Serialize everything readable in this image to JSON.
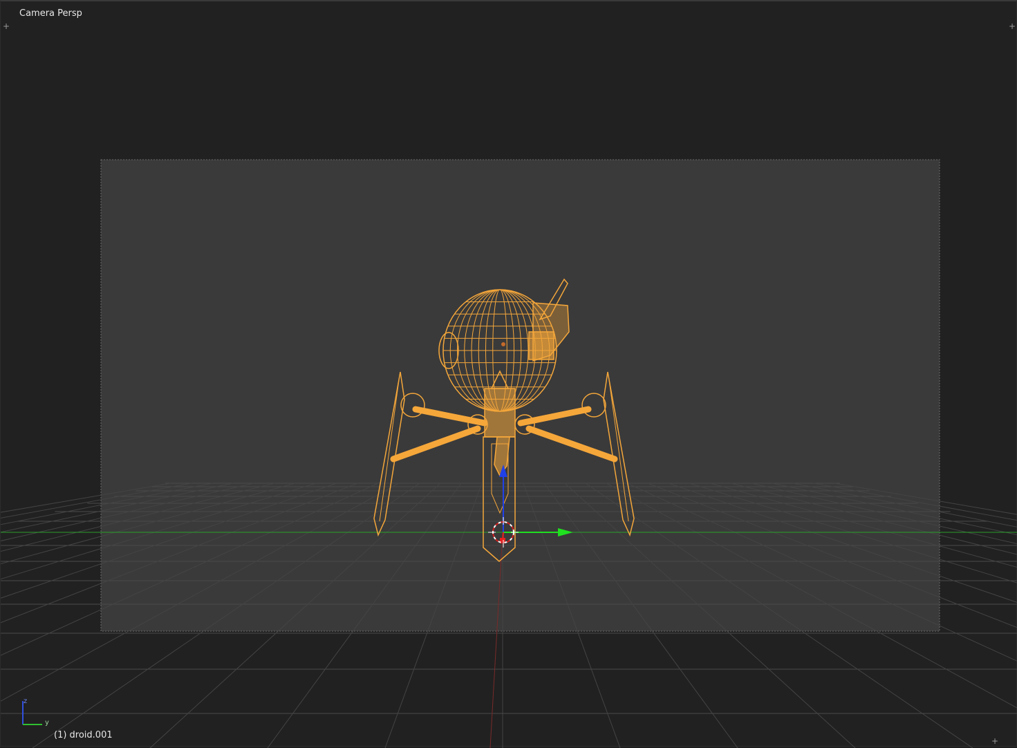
{
  "viewport": {
    "view_label": "Camera Persp",
    "object_label": "(1) droid.001",
    "corner_glyph": "+"
  },
  "axis_gizmo": {
    "z_label": "z",
    "y_label": "y"
  },
  "colors": {
    "background": "#212121",
    "camera_frame": "#3a3a3a",
    "grid": "#4a4a4a",
    "x_axis_line": "#8a2f2f",
    "y_axis_line": "#2fbf2f",
    "selection_wire": "#f5a73a",
    "manipulator_x": "#e82020",
    "manipulator_y": "#20e020",
    "manipulator_z": "#2040e8"
  },
  "icons": {
    "corner_top_left": "plus-icon",
    "corner_top_right": "plus-icon",
    "corner_bottom_right": "plus-icon",
    "cursor_3d": "3d-cursor-icon"
  }
}
